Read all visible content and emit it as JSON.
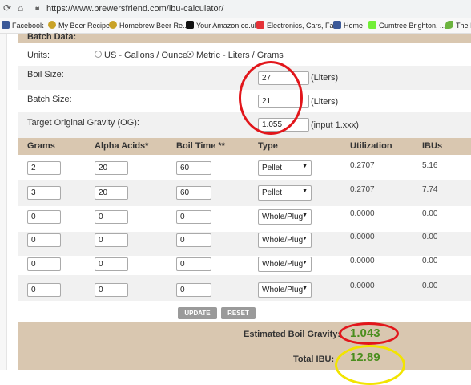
{
  "browser": {
    "url": "https://www.brewersfriend.com/ibu-calculator/",
    "bookmarks": [
      {
        "label": "Facebook",
        "color": "#3b5998"
      },
      {
        "label": "My Beer Recipes",
        "color": "#c9a227"
      },
      {
        "label": "Homebrew Beer Re...",
        "color": "#c9a227"
      },
      {
        "label": "Your Amazon.co.uk",
        "color": "#111111"
      },
      {
        "label": "Electronics, Cars, Fa...",
        "color": "#e43137"
      },
      {
        "label": "Home",
        "color": "#3b5998"
      },
      {
        "label": "Gumtree Brighton, ...",
        "color": "#72ef36"
      },
      {
        "label": "The I",
        "color": "#6bb33e"
      }
    ]
  },
  "batch": {
    "header": "Batch Data:",
    "units_label": "Units:",
    "unit_us": "US - Gallons / Ounces",
    "unit_metric": "Metric - Liters / Grams",
    "boil_label": "Boil Size:",
    "boil_value": "27",
    "boil_unit": "(Liters)",
    "batch_label": "Batch Size:",
    "batch_value": "21",
    "batch_unit": "(Liters)",
    "og_label": "Target Original Gravity (OG):",
    "og_value": "1.055",
    "og_hint": "(input 1.xxx)"
  },
  "table": {
    "headers": {
      "grams": "Grams",
      "alpha": "Alpha Acids*",
      "boil": "Boil Time **",
      "type": "Type",
      "util": "Utilization",
      "ibus": "IBUs"
    },
    "rows": [
      {
        "grams": "2",
        "alpha": "20",
        "boil": "60",
        "type": "Pellet",
        "util": "0.2707",
        "ibus": "5.16"
      },
      {
        "grams": "3",
        "alpha": "20",
        "boil": "60",
        "type": "Pellet",
        "util": "0.2707",
        "ibus": "7.74"
      },
      {
        "grams": "0",
        "alpha": "0",
        "boil": "0",
        "type": "Whole/Plug",
        "util": "0.0000",
        "ibus": "0.00"
      },
      {
        "grams": "0",
        "alpha": "0",
        "boil": "0",
        "type": "Whole/Plug",
        "util": "0.0000",
        "ibus": "0.00"
      },
      {
        "grams": "0",
        "alpha": "0",
        "boil": "0",
        "type": "Whole/Plug",
        "util": "0.0000",
        "ibus": "0.00"
      },
      {
        "grams": "0",
        "alpha": "0",
        "boil": "0",
        "type": "Whole/Plug",
        "util": "0.0000",
        "ibus": "0.00"
      }
    ]
  },
  "buttons": {
    "update": "UPDATE",
    "reset": "RESET"
  },
  "results": {
    "gravity_label": "Estimated Boil Gravity:",
    "gravity_value": "1.043",
    "ibu_label": "Total IBU:",
    "ibu_value": "12.89"
  }
}
